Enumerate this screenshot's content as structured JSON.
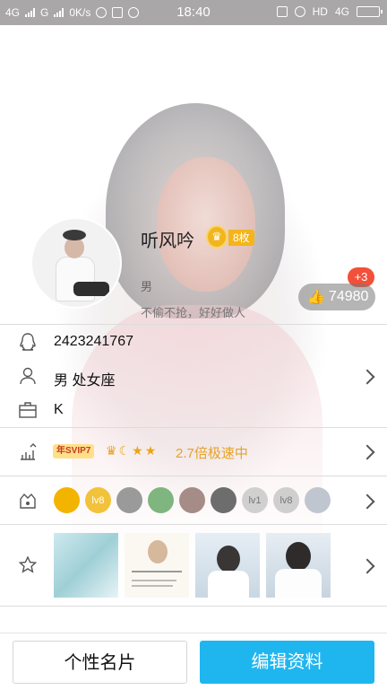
{
  "status_bar": {
    "left_items": [
      "4G",
      "G",
      "0K/s"
    ],
    "time": "18:40",
    "right_items": [
      "HD",
      "4G"
    ]
  },
  "profile": {
    "nickname": "听风吟",
    "medal_count": "8枚",
    "gender": "男",
    "signature": "不偷不抢，好好做人",
    "like_increment": "+3",
    "like_count": "74980"
  },
  "info": {
    "qq_number": "2423241767",
    "gender_zodiac": "男  处女座",
    "company": "K"
  },
  "vip": {
    "tag": "年SVIP7",
    "speed_text": "2.7倍极速中"
  },
  "badges": [
    {
      "name": "qq-penguin-badge",
      "color": "#f3b400",
      "text": ""
    },
    {
      "name": "diamond-badge",
      "color": "#f2c23a",
      "text": "lv8"
    },
    {
      "name": "penguin-gray-badge",
      "color": "#9a9a9a",
      "text": ""
    },
    {
      "name": "penguin-green-badge",
      "color": "#7fb57f",
      "text": ""
    },
    {
      "name": "penguin-red-badge",
      "color": "#a58c86",
      "text": ""
    },
    {
      "name": "crown-penguin-badge",
      "color": "#6d6d6d",
      "text": ""
    },
    {
      "name": "cloud-badge",
      "color": "#d0d0d0",
      "text": "lv1"
    },
    {
      "name": "silver-diamond-badge",
      "color": "#cfcfcf",
      "text": "lv8"
    },
    {
      "name": "star-badge",
      "color": "#bfc6cf",
      "text": ""
    }
  ],
  "colors": {
    "accent_blue": "#1fb6ef",
    "like_red": "#f2503a",
    "vip_orange": "#e7a227"
  },
  "bottom_bar": {
    "card_label": "个性名片",
    "edit_label": "编辑资料"
  }
}
